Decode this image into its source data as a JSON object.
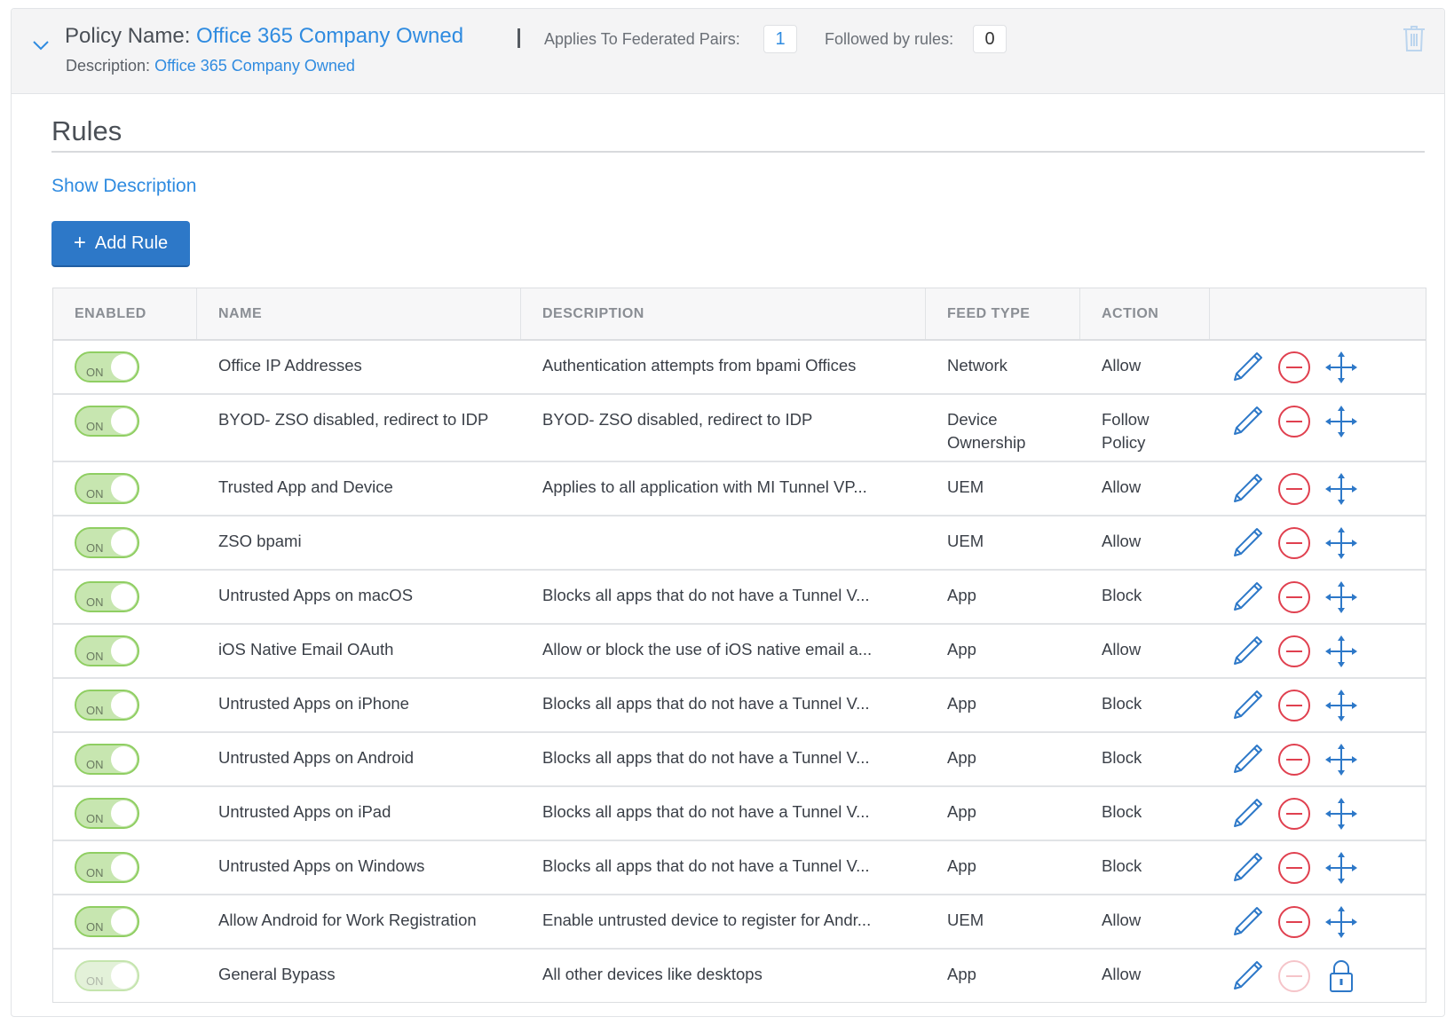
{
  "policy": {
    "name_label": "Policy Name:",
    "name_value": "Office 365 Company Owned",
    "description_label": "Description:",
    "description_value": "Office 365 Company Owned",
    "separator": "|",
    "federated_pairs_label": "Applies To Federated Pairs:",
    "federated_pairs_value": "1",
    "followed_by_label": "Followed by rules:",
    "followed_by_value": "0",
    "collapse_icon": "chevron-down-icon",
    "delete_icon": "trash-icon"
  },
  "rules": {
    "title": "Rules",
    "show_description": "Show Description",
    "add_rule_icon": "+",
    "add_rule_label": "Add Rule",
    "columns": [
      "ENABLED",
      "NAME",
      "DESCRIPTION",
      "FEED TYPE",
      "ACTION",
      ""
    ],
    "toggle_label": "ON",
    "rows": [
      {
        "enabled": true,
        "toggle_disabled": false,
        "name": "Office IP Addresses",
        "description": "Authentication attempts from bpami Offices",
        "feed_type": "Network",
        "action": "Allow",
        "last_icon": "move-icon",
        "delete_disabled": false
      },
      {
        "enabled": true,
        "toggle_disabled": false,
        "name": "BYOD- ZSO disabled, redirect to IDP",
        "description": "BYOD- ZSO disabled, redirect to IDP",
        "feed_type": "Device Ownership",
        "action": "Follow Policy",
        "last_icon": "move-icon",
        "delete_disabled": false
      },
      {
        "enabled": true,
        "toggle_disabled": false,
        "name": "Trusted App and Device",
        "description": "Applies to all application with MI Tunnel VP...",
        "feed_type": "UEM",
        "action": "Allow",
        "last_icon": "move-icon",
        "delete_disabled": false
      },
      {
        "enabled": true,
        "toggle_disabled": false,
        "name": "ZSO bpami",
        "description": "",
        "feed_type": "UEM",
        "action": "Allow",
        "last_icon": "move-icon",
        "delete_disabled": false
      },
      {
        "enabled": true,
        "toggle_disabled": false,
        "name": "Untrusted Apps on macOS",
        "description": "Blocks all apps that do not have a Tunnel V...",
        "feed_type": "App",
        "action": "Block",
        "last_icon": "move-icon",
        "delete_disabled": false
      },
      {
        "enabled": true,
        "toggle_disabled": false,
        "name": "iOS Native Email OAuth",
        "description": "Allow or block the use of iOS native email a...",
        "feed_type": "App",
        "action": "Allow",
        "last_icon": "move-icon",
        "delete_disabled": false
      },
      {
        "enabled": true,
        "toggle_disabled": false,
        "name": "Untrusted Apps on iPhone",
        "description": "Blocks all apps that do not have a Tunnel V...",
        "feed_type": "App",
        "action": "Block",
        "last_icon": "move-icon",
        "delete_disabled": false
      },
      {
        "enabled": true,
        "toggle_disabled": false,
        "name": "Untrusted Apps on Android",
        "description": "Blocks all apps that do not have a Tunnel V...",
        "feed_type": "App",
        "action": "Block",
        "last_icon": "move-icon",
        "delete_disabled": false
      },
      {
        "enabled": true,
        "toggle_disabled": false,
        "name": "Untrusted Apps on iPad",
        "description": "Blocks all apps that do not have a Tunnel V...",
        "feed_type": "App",
        "action": "Block",
        "last_icon": "move-icon",
        "delete_disabled": false
      },
      {
        "enabled": true,
        "toggle_disabled": false,
        "name": "Untrusted Apps on Windows",
        "description": "Blocks all apps that do not have a Tunnel V...",
        "feed_type": "App",
        "action": "Block",
        "last_icon": "move-icon",
        "delete_disabled": false
      },
      {
        "enabled": true,
        "toggle_disabled": false,
        "name": "Allow Android for Work Registration",
        "description": "Enable untrusted device to register for Andr...",
        "feed_type": "UEM",
        "action": "Allow",
        "last_icon": "move-icon",
        "delete_disabled": false
      },
      {
        "enabled": true,
        "toggle_disabled": true,
        "name": "General Bypass",
        "description": "All other devices like desktops",
        "feed_type": "App",
        "action": "Allow",
        "last_icon": "lock-icon",
        "delete_disabled": true
      }
    ]
  },
  "colors": {
    "link": "#2f8be0",
    "primary_button": "#2d78c8",
    "toggle_on": "#8fce62",
    "delete": "#e0404f",
    "icon_blue": "#2d78c8"
  }
}
